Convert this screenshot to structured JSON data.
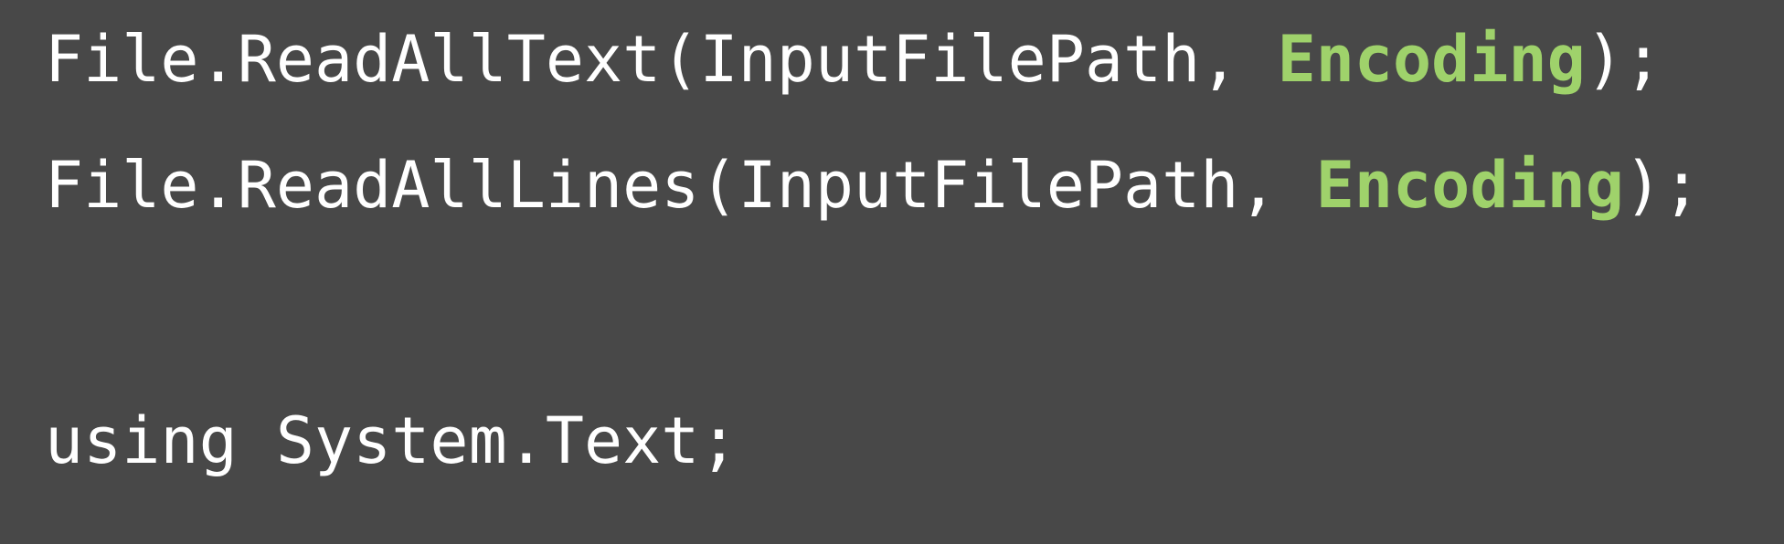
{
  "code": {
    "lines": [
      {
        "before": "File.ReadAllText(InputFilePath, ",
        "highlight": "Encoding",
        "after": ");"
      },
      {
        "before": "File.ReadAllLines(InputFilePath, ",
        "highlight": "Encoding",
        "after": ");"
      },
      {
        "text": "using System.Text;"
      }
    ]
  },
  "colors": {
    "background": "#484848",
    "text": "#ffffff",
    "highlight": "#9fd26b"
  }
}
